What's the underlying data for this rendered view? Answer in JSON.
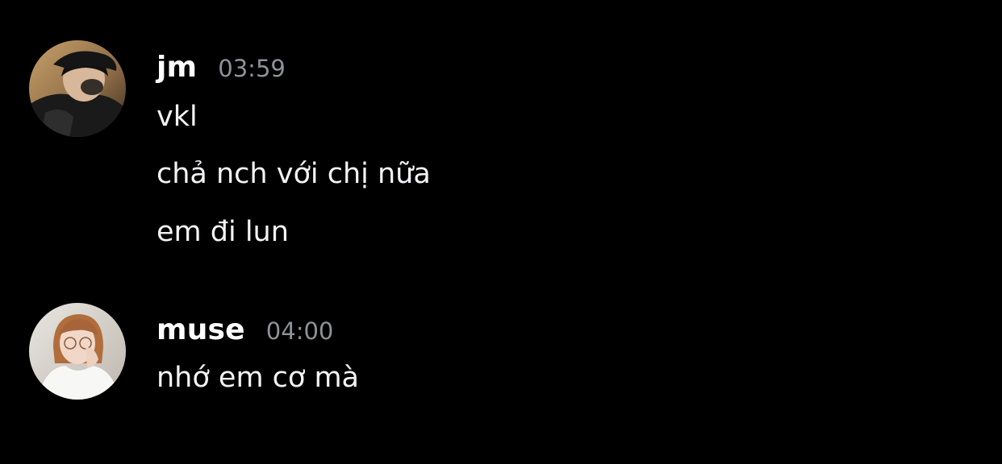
{
  "messages": [
    {
      "username": "jm",
      "timestamp": "03:59",
      "avatar_icon": "user-avatar-icon",
      "lines": [
        "vkl",
        "chả nch với chị nữa",
        "em đi lun"
      ]
    },
    {
      "username": "muse",
      "timestamp": "04:00",
      "avatar_icon": "user-avatar-icon",
      "lines": [
        "nhớ em cơ mà"
      ]
    }
  ],
  "colors": {
    "background": "#000000",
    "username": "#ffffff",
    "timestamp": "#8e9297",
    "message_text": "#f2f3f5"
  }
}
